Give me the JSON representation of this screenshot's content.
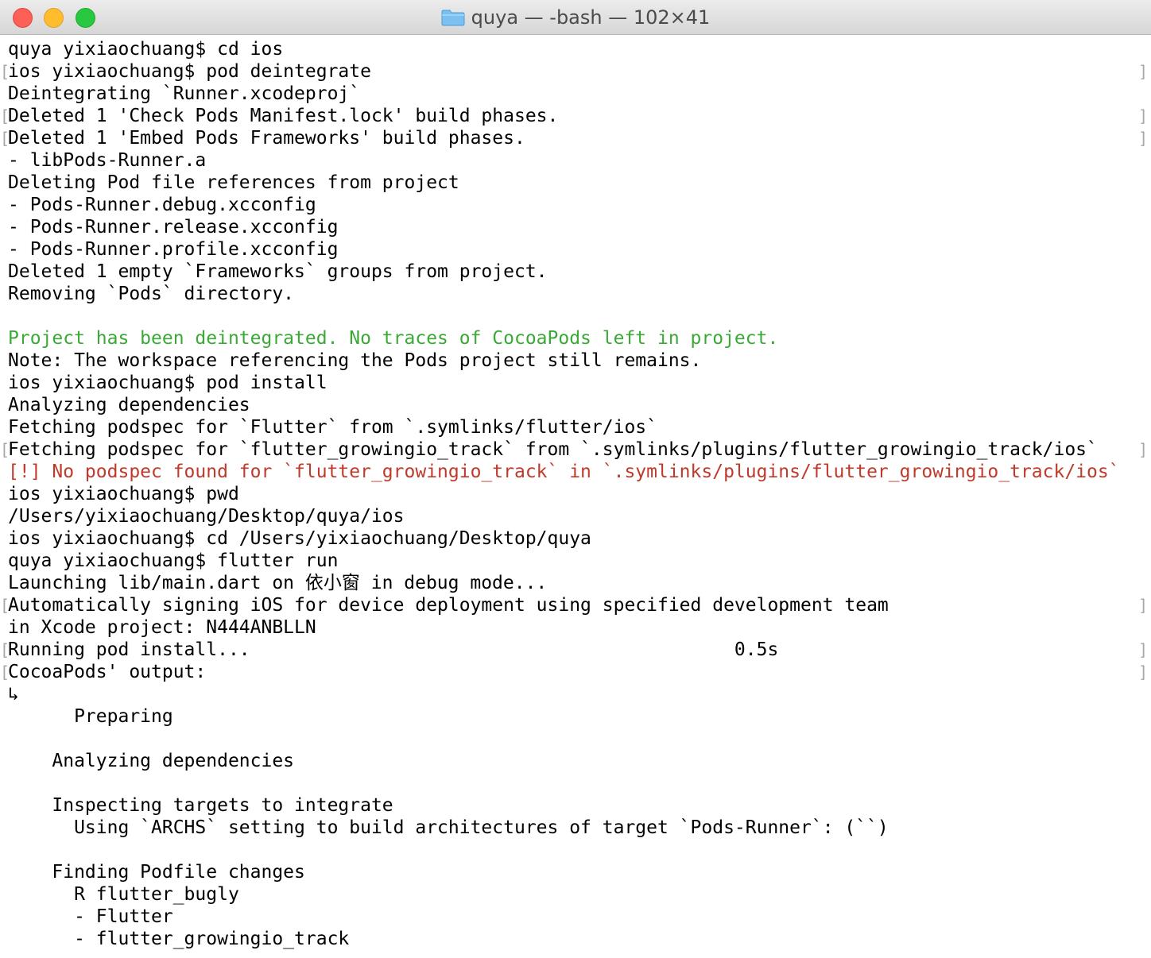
{
  "window": {
    "title": "quya — -bash — 102×41",
    "folder_icon": "folder-icon",
    "colors": {
      "close": "#fe5f57",
      "minimize": "#febc2e",
      "zoom": "#28c840",
      "green_text": "#3aa936",
      "red_text": "#c0392b"
    }
  },
  "terminal": {
    "lines": [
      {
        "text": "quya yixiaochuang$ cd ios",
        "color": "default",
        "bracket_left": false,
        "bracket_right": false
      },
      {
        "text": "ios yixiaochuang$ pod deintegrate",
        "color": "default",
        "bracket_left": true,
        "bracket_right": true
      },
      {
        "text": "Deintegrating `Runner.xcodeproj`",
        "color": "default",
        "bracket_left": false,
        "bracket_right": false
      },
      {
        "text": "Deleted 1 'Check Pods Manifest.lock' build phases.",
        "color": "default",
        "bracket_left": true,
        "bracket_right": true
      },
      {
        "text": "Deleted 1 'Embed Pods Frameworks' build phases.",
        "color": "default",
        "bracket_left": true,
        "bracket_right": true
      },
      {
        "text": "- libPods-Runner.a",
        "color": "default",
        "bracket_left": false,
        "bracket_right": false
      },
      {
        "text": "Deleting Pod file references from project",
        "color": "default",
        "bracket_left": false,
        "bracket_right": false
      },
      {
        "text": "- Pods-Runner.debug.xcconfig",
        "color": "default",
        "bracket_left": false,
        "bracket_right": false
      },
      {
        "text": "- Pods-Runner.release.xcconfig",
        "color": "default",
        "bracket_left": false,
        "bracket_right": false
      },
      {
        "text": "- Pods-Runner.profile.xcconfig",
        "color": "default",
        "bracket_left": false,
        "bracket_right": false
      },
      {
        "text": "Deleted 1 empty `Frameworks` groups from project.",
        "color": "default",
        "bracket_left": false,
        "bracket_right": false
      },
      {
        "text": "Removing `Pods` directory.",
        "color": "default",
        "bracket_left": false,
        "bracket_right": false
      },
      {
        "text": "",
        "color": "default",
        "bracket_left": false,
        "bracket_right": false
      },
      {
        "text": "Project has been deintegrated. No traces of CocoaPods left in project.",
        "color": "green",
        "bracket_left": false,
        "bracket_right": false
      },
      {
        "text": "Note: The workspace referencing the Pods project still remains.",
        "color": "default",
        "bracket_left": false,
        "bracket_right": false
      },
      {
        "text": "ios yixiaochuang$ pod install",
        "color": "default",
        "bracket_left": false,
        "bracket_right": false
      },
      {
        "text": "Analyzing dependencies",
        "color": "default",
        "bracket_left": false,
        "bracket_right": false
      },
      {
        "text": "Fetching podspec for `Flutter` from `.symlinks/flutter/ios`",
        "color": "default",
        "bracket_left": false,
        "bracket_right": false
      },
      {
        "text": "Fetching podspec for `flutter_growingio_track` from `.symlinks/plugins/flutter_growingio_track/ios`",
        "color": "default",
        "bracket_left": true,
        "bracket_right": true
      },
      {
        "text": "[!] No podspec found for `flutter_growingio_track` in `.symlinks/plugins/flutter_growingio_track/ios`",
        "color": "red",
        "bracket_left": false,
        "bracket_right": false
      },
      {
        "text": "ios yixiaochuang$ pwd",
        "color": "default",
        "bracket_left": false,
        "bracket_right": false
      },
      {
        "text": "/Users/yixiaochuang/Desktop/quya/ios",
        "color": "default",
        "bracket_left": false,
        "bracket_right": false
      },
      {
        "text": "ios yixiaochuang$ cd /Users/yixiaochuang/Desktop/quya",
        "color": "default",
        "bracket_left": false,
        "bracket_right": false
      },
      {
        "text": "quya yixiaochuang$ flutter run",
        "color": "default",
        "bracket_left": false,
        "bracket_right": false
      },
      {
        "text": "Launching lib/main.dart on 依小窗 in debug mode...",
        "color": "default",
        "bracket_left": false,
        "bracket_right": false
      },
      {
        "text": "Automatically signing iOS for device deployment using specified development team",
        "color": "default",
        "bracket_left": true,
        "bracket_right": true
      },
      {
        "text": "in Xcode project: N444ANBLLN",
        "color": "default",
        "bracket_left": false,
        "bracket_right": false
      },
      {
        "text": "Running pod install...                                            0.5s",
        "color": "default",
        "bracket_left": true,
        "bracket_right": true
      },
      {
        "text": "CocoaPods' output:",
        "color": "default",
        "bracket_left": true,
        "bracket_right": true
      },
      {
        "text": "↳",
        "color": "default",
        "bracket_left": false,
        "bracket_right": false
      },
      {
        "text": "      Preparing",
        "color": "default",
        "bracket_left": false,
        "bracket_right": false
      },
      {
        "text": "",
        "color": "default",
        "bracket_left": false,
        "bracket_right": false
      },
      {
        "text": "    Analyzing dependencies",
        "color": "default",
        "bracket_left": false,
        "bracket_right": false
      },
      {
        "text": "",
        "color": "default",
        "bracket_left": false,
        "bracket_right": false
      },
      {
        "text": "    Inspecting targets to integrate",
        "color": "default",
        "bracket_left": false,
        "bracket_right": false
      },
      {
        "text": "      Using `ARCHS` setting to build architectures of target `Pods-Runner`: (``)",
        "color": "default",
        "bracket_left": false,
        "bracket_right": false
      },
      {
        "text": "",
        "color": "default",
        "bracket_left": false,
        "bracket_right": false
      },
      {
        "text": "    Finding Podfile changes",
        "color": "default",
        "bracket_left": false,
        "bracket_right": false
      },
      {
        "text": "      R flutter_bugly",
        "color": "default",
        "bracket_left": false,
        "bracket_right": false
      },
      {
        "text": "      - Flutter",
        "color": "default",
        "bracket_left": false,
        "bracket_right": false
      },
      {
        "text": "      - flutter_growingio_track",
        "color": "default",
        "bracket_left": false,
        "bracket_right": false
      }
    ]
  }
}
